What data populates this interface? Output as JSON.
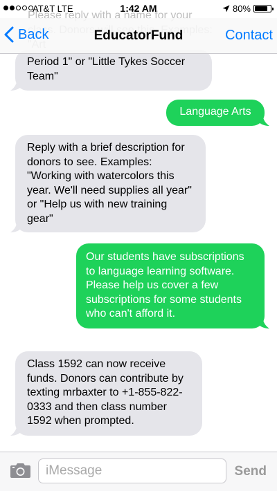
{
  "status_bar": {
    "carrier": "AT&T LTE",
    "time": "1:42 AM",
    "battery": "80%",
    "battery_level": 0.8,
    "signal_bars": 2
  },
  "nav": {
    "back_label": "Back",
    "title": "EducatorFund",
    "contact_label": "Contact"
  },
  "ghost_text": "Please reply with a name for your class. Donors will see this. Examples: \"Art",
  "messages": [
    {
      "direction": "in",
      "text": "Period  1\" or \"Little Tykes Soccer Team\""
    },
    {
      "direction": "out",
      "text": "Language Arts"
    },
    {
      "direction": "in",
      "text": "Reply with a brief description for donors to see.  Examples: \"Working with watercolors this year.  We'll need supplies all year\" or \"Help us with new training gear\""
    },
    {
      "direction": "out",
      "text": "Our students have subscriptions to language learning software.  Please help us cover a few subscriptions for some students who can't afford it."
    },
    {
      "direction": "in",
      "text": "Class 1592 can now receive funds.  Donors can contribute by texting mrbaxter to +1-855-822-0333 and then class number 1592 when prompted."
    }
  ],
  "input": {
    "placeholder": "iMessage",
    "send_label": "Send"
  },
  "colors": {
    "accent": "#007aff",
    "outgoing_bubble": "#1ed25a",
    "incoming_bubble": "#e5e5ea"
  },
  "icons": {
    "back": "chevron-left-icon",
    "location": "location-arrow-icon",
    "camera": "camera-icon"
  }
}
